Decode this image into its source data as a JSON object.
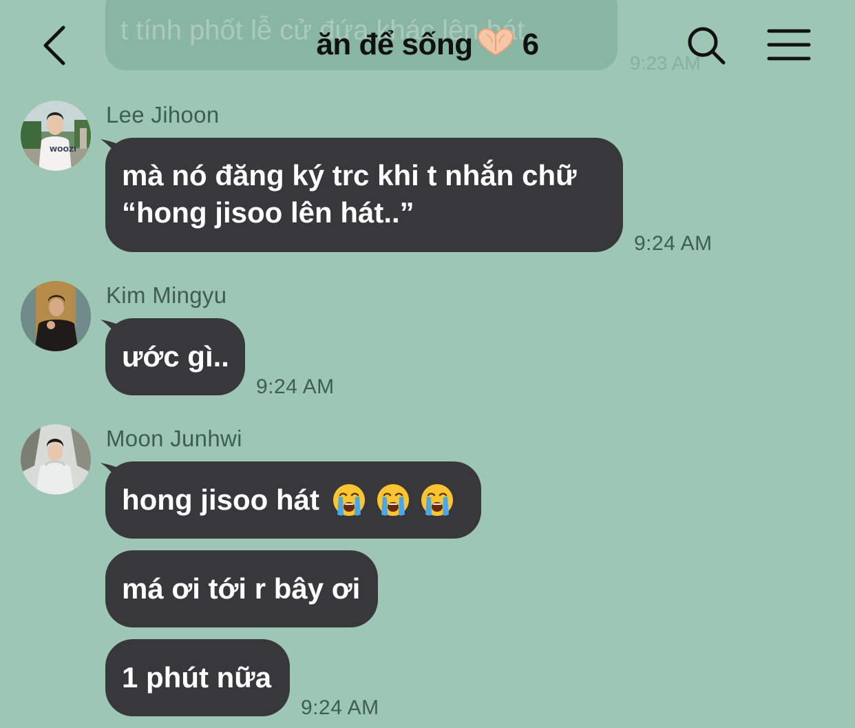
{
  "header": {
    "title": "ăn để sống",
    "title_emoji": "heart-hands-emoji",
    "member_count": "6"
  },
  "ghost": {
    "text": "t tính phốt lễ cử đứa khác lên hát",
    "time": "9:23 AM"
  },
  "messages": [
    {
      "sender": "Lee Jihoon",
      "text": "mà nó đăng ký trc khi t nhắn chữ “hong jisoo lên hát..”",
      "time": "9:24 AM"
    },
    {
      "sender": "Kim Mingyu",
      "text": "ước gì..",
      "time": "9:24 AM"
    },
    {
      "sender": "Moon Junhwi",
      "bubbles": [
        "hong jisoo hát",
        "má ơi tới r bây ơi",
        "1 phút nữa"
      ],
      "bubble_emoji": "loudly-crying-face-emoji",
      "time": "9:24 AM"
    }
  ],
  "colors": {
    "background": "#9dc6b4",
    "bubble": "#38383b",
    "bubble_text": "#ffffff",
    "meta_text": "#3e5e52"
  }
}
